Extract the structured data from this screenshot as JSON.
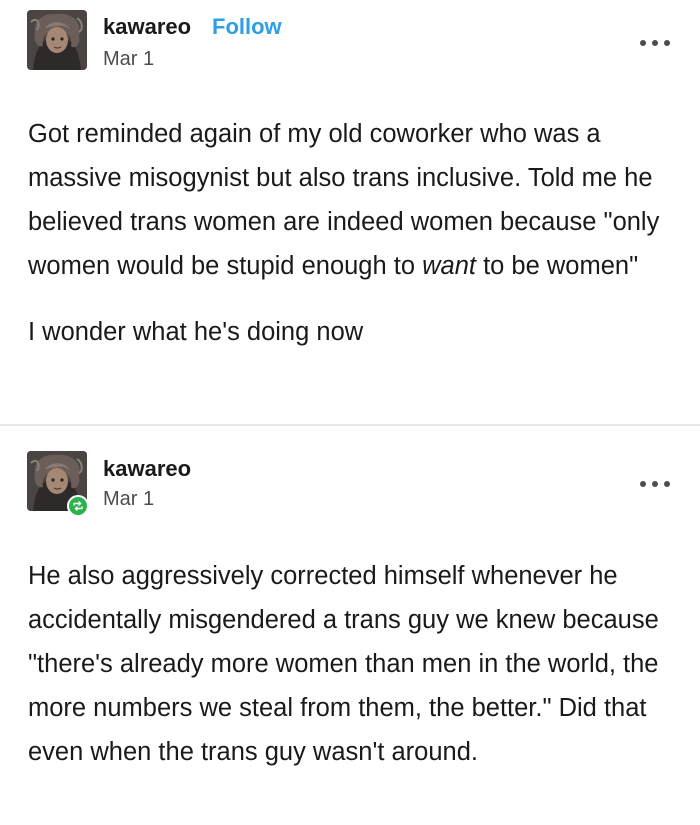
{
  "posts": [
    {
      "username": "kawareo",
      "follow_label": "Follow",
      "date": "Mar 1",
      "icons": {
        "avatar": "user-avatar",
        "more": "more-options-icon"
      },
      "paragraphs": [
        {
          "before": "Got reminded again of my old coworker who was a massive misogynist but also trans inclusive. Told me he believed trans women are indeed women because \"only women would be stupid enough to ",
          "emphasis": "want",
          "after": " to be women\""
        },
        {
          "text": "I wonder what he's doing now"
        }
      ]
    },
    {
      "username": "kawareo",
      "date": "Mar 1",
      "icons": {
        "avatar": "user-avatar",
        "badge": "reblog-icon",
        "more": "more-options-icon"
      },
      "reblog_badge_color": "#2bb24c",
      "paragraphs": [
        {
          "text": "He also aggressively corrected himself whenever he accidentally misgendered a trans guy we knew because \"there's already more women than men in the world, the more numbers we steal from them, the better.\" Did that even when the trans guy wasn't around."
        }
      ]
    }
  ],
  "colors": {
    "follow": "#2c9fe6",
    "text": "#1a1a1a",
    "muted": "#4d4d4d",
    "divider": "#e9e9e9"
  }
}
